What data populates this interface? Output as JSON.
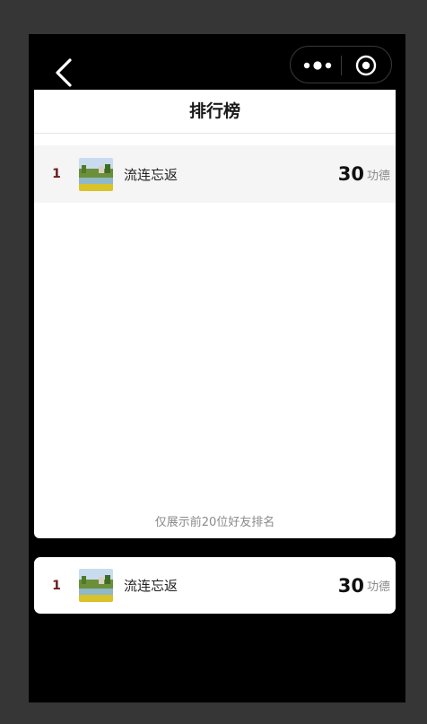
{
  "nav": {
    "back_icon": "chevron-left-icon",
    "more_icon": "more-dots-icon",
    "close_icon": "target-circle-icon"
  },
  "page": {
    "title": "排行榜",
    "footnote": "仅展示前20位好友排名"
  },
  "ranking": [
    {
      "rank": "1",
      "name": "流连忘返",
      "score": "30",
      "unit": "功德",
      "avatar_icon": "landscape-avatar"
    }
  ],
  "my_rank": {
    "rank": "1",
    "name": "流连忘返",
    "score": "30",
    "unit": "功德",
    "avatar_icon": "landscape-avatar"
  },
  "colors": {
    "background": "#363636",
    "phone": "#000000",
    "rank_text": "#6b1d1d",
    "highlight_row": "#f5f5f5"
  }
}
